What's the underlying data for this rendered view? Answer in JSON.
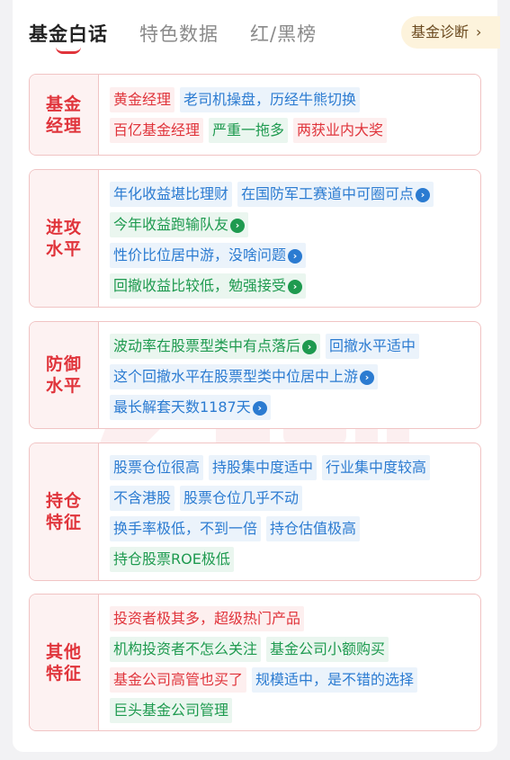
{
  "tabs": [
    {
      "label": "基金白话"
    },
    {
      "label": "特色数据"
    },
    {
      "label": "红/黑榜"
    }
  ],
  "diagnosis_button": {
    "label": "基金诊断",
    "chevron": "›"
  },
  "arrow_glyph": "›",
  "colors": {
    "accent_red": "#e0343b",
    "tag_blue": "#2b7bd1",
    "tag_green": "#1e9a4f",
    "border_pink": "#f1c4c4"
  },
  "sections": [
    {
      "label_line1": "基金",
      "label_line2": "经理",
      "rows": [
        [
          {
            "text": "黄金经理",
            "color": "red"
          },
          {
            "text": "老司机操盘，历经牛熊切换",
            "color": "blue"
          }
        ],
        [
          {
            "text": "百亿基金经理",
            "color": "red"
          },
          {
            "text": "严重一拖多",
            "color": "green"
          },
          {
            "text": "两获业内大奖",
            "color": "red"
          }
        ]
      ]
    },
    {
      "label_line1": "进攻",
      "label_line2": "水平",
      "rows": [
        [
          {
            "text": "年化收益堪比理财",
            "color": "blue"
          },
          {
            "text": "在国防军工赛道中可圈可点",
            "color": "blue",
            "arrow": true
          }
        ],
        [
          {
            "text": "今年收益跑输队友",
            "color": "green",
            "arrow": true
          }
        ],
        [
          {
            "text": "性价比位居中游，没啥问题",
            "color": "blue",
            "arrow": true
          }
        ],
        [
          {
            "text": "回撤收益比较低，勉强接受",
            "color": "green",
            "arrow": true
          }
        ]
      ]
    },
    {
      "label_line1": "防御",
      "label_line2": "水平",
      "rows": [
        [
          {
            "text": "波动率在股票型类中有点落后",
            "color": "green",
            "arrow": true
          },
          {
            "text": "回撤水平适中",
            "color": "blue"
          }
        ],
        [
          {
            "text": "这个回撤水平在股票型类中位居中上游",
            "color": "blue",
            "arrow": true
          }
        ],
        [
          {
            "text": "最长解套天数1187天",
            "color": "blue",
            "arrow": true
          }
        ]
      ]
    },
    {
      "label_line1": "持仓",
      "label_line2": "特征",
      "rows": [
        [
          {
            "text": "股票仓位很高",
            "color": "blue"
          },
          {
            "text": "持股集中度适中",
            "color": "blue"
          },
          {
            "text": "行业集中度较高",
            "color": "blue"
          }
        ],
        [
          {
            "text": "不含港股",
            "color": "blue"
          },
          {
            "text": "股票仓位几乎不动",
            "color": "blue"
          }
        ],
        [
          {
            "text": "换手率极低，不到一倍",
            "color": "blue"
          },
          {
            "text": "持仓估值极高",
            "color": "blue"
          }
        ],
        [
          {
            "text": "持仓股票ROE极低",
            "color": "green"
          }
        ]
      ]
    },
    {
      "label_line1": "其他",
      "label_line2": "特征",
      "rows": [
        [
          {
            "text": "投资者极其多，超级热门产品",
            "color": "red"
          }
        ],
        [
          {
            "text": "机构投资者不怎么关注",
            "color": "green"
          },
          {
            "text": "基金公司小额购买",
            "color": "green"
          }
        ],
        [
          {
            "text": "基金公司高管也买了",
            "color": "red"
          },
          {
            "text": "规模适中，是不错的选择",
            "color": "blue"
          }
        ],
        [
          {
            "text": "巨头基金公司管理",
            "color": "green"
          }
        ]
      ]
    }
  ]
}
